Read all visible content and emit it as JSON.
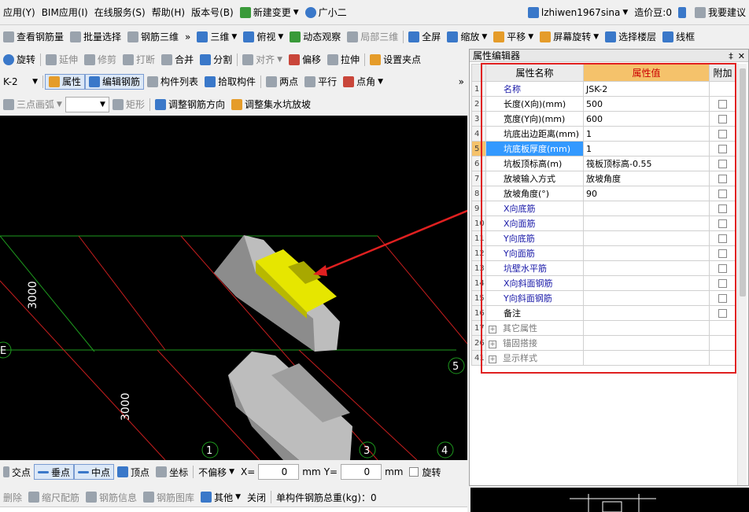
{
  "menubar": {
    "items": [
      "应用(Y)",
      "BIM应用(I)",
      "在线服务(S)",
      "帮助(H)",
      "版本号(B)"
    ],
    "new_change": "新建变更",
    "assistant": "广小二",
    "user": "lzhiwen1967sina",
    "beans": "造价豆:0",
    "suggest": "我要建议"
  },
  "toolbar1": {
    "left": [
      "查看钢筋量",
      "批量选择",
      "钢筋三维"
    ],
    "right": [
      "三维",
      "俯视",
      "动态观察",
      "局部三维",
      "全屏",
      "缩放",
      "平移",
      "屏幕旋转",
      "选择楼层",
      "线框"
    ]
  },
  "toolbar2": [
    "旋转",
    "延伸",
    "修剪",
    "打断",
    "合并",
    "分割",
    "对齐",
    "偏移",
    "拉伸",
    "设置夹点"
  ],
  "toolbar3": {
    "combo": "K-2",
    "items": [
      "属性",
      "编辑钢筋",
      "构件列表",
      "拾取构件",
      "两点",
      "平行",
      "点角"
    ]
  },
  "toolbar4": [
    "三点画弧",
    "矩形",
    "调整钢筋方向",
    "调整集水坑放坡"
  ],
  "canvas": {
    "labels": {
      "dim_left": "3000",
      "dim_mid": "3000",
      "axis_e": "E",
      "axis_1": "1",
      "axis_3": "3",
      "axis_4": "4",
      "axis_5": "5"
    }
  },
  "snapbar": {
    "items": [
      "交点",
      "垂点",
      "中点",
      "顶点",
      "坐标"
    ],
    "offset_mode": "不偏移",
    "x_label": "X=",
    "x_value": "0",
    "y_label": "Y=",
    "y_value": "0",
    "unit": "mm",
    "rotate": "旋转"
  },
  "statusbar": {
    "items": [
      "删除",
      "缩尺配筋",
      "钢筋信息",
      "钢筋图库",
      "其他",
      "关闭"
    ],
    "total": "单构件钢筋总重(kg)：0"
  },
  "panel": {
    "title": "属性编辑器",
    "headers": [
      "属性名称",
      "属性值",
      "附加"
    ],
    "rows": [
      {
        "num": "1",
        "name": "名称",
        "value": "JSK-2",
        "style": "blue",
        "check": false
      },
      {
        "num": "2",
        "name": "长度(X向)(mm)",
        "value": "500",
        "style": "",
        "check": true
      },
      {
        "num": "3",
        "name": "宽度(Y向)(mm)",
        "value": "600",
        "style": "",
        "check": true
      },
      {
        "num": "4",
        "name": "坑底出边距离(mm)",
        "value": "1",
        "style": "",
        "check": true
      },
      {
        "num": "5",
        "name": "坑底板厚度(mm)",
        "value": "1",
        "style": "sel",
        "check": true
      },
      {
        "num": "6",
        "name": "坑板顶标高(m)",
        "value": "筏板顶标高-0.55",
        "style": "",
        "check": true
      },
      {
        "num": "7",
        "name": "放坡输入方式",
        "value": "放坡角度",
        "style": "",
        "check": true
      },
      {
        "num": "8",
        "name": "放坡角度(°)",
        "value": "90",
        "style": "",
        "check": true
      },
      {
        "num": "9",
        "name": "X向底筋",
        "value": "",
        "style": "blue",
        "check": true
      },
      {
        "num": "10",
        "name": "X向面筋",
        "value": "",
        "style": "blue",
        "check": true
      },
      {
        "num": "11",
        "name": "Y向底筋",
        "value": "",
        "style": "blue",
        "check": true
      },
      {
        "num": "12",
        "name": "Y向面筋",
        "value": "",
        "style": "blue",
        "check": true
      },
      {
        "num": "13",
        "name": "坑壁水平筋",
        "value": "",
        "style": "blue",
        "check": true
      },
      {
        "num": "14",
        "name": "X向斜面钢筋",
        "value": "",
        "style": "blue",
        "check": true
      },
      {
        "num": "15",
        "name": "Y向斜面钢筋",
        "value": "",
        "style": "blue",
        "check": true
      },
      {
        "num": "16",
        "name": "备注",
        "value": "",
        "style": "",
        "check": true
      },
      {
        "num": "17",
        "name": "其它属性",
        "value": "",
        "style": "group",
        "check": false
      },
      {
        "num": "26",
        "name": "锚固搭接",
        "value": "",
        "style": "group",
        "check": false
      },
      {
        "num": "41",
        "name": "显示样式",
        "value": "",
        "style": "group",
        "check": false
      }
    ]
  },
  "colors": {
    "highlight": "#e02020",
    "selected_row": "#3399ff",
    "value_header": "#f5c26b",
    "pit_yellow": "#e6e600"
  }
}
